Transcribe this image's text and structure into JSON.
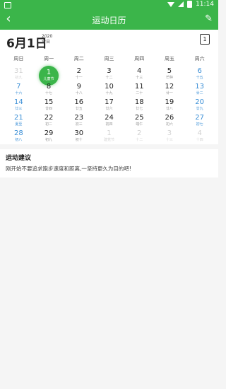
{
  "status": {
    "time": "11:14"
  },
  "appbar": {
    "title": "运动日历",
    "back": "‹",
    "share": "✎"
  },
  "header": {
    "date": "6月1日",
    "year": "2020",
    "today": "今日",
    "calendar_label": "1"
  },
  "weekdays": [
    "周日",
    "周一",
    "周二",
    "周三",
    "周四",
    "周五",
    "周六"
  ],
  "days": [
    {
      "n": "31",
      "l": "初九",
      "state": "dim"
    },
    {
      "n": "1",
      "l": "儿童节",
      "state": "today"
    },
    {
      "n": "2",
      "l": "十一",
      "state": ""
    },
    {
      "n": "3",
      "l": "十二",
      "state": ""
    },
    {
      "n": "4",
      "l": "十三",
      "state": ""
    },
    {
      "n": "5",
      "l": "芒种",
      "state": ""
    },
    {
      "n": "6",
      "l": "十五",
      "state": "wk"
    },
    {
      "n": "7",
      "l": "十六",
      "state": "wk"
    },
    {
      "n": "8",
      "l": "十七",
      "state": ""
    },
    {
      "n": "9",
      "l": "十八",
      "state": ""
    },
    {
      "n": "10",
      "l": "十九",
      "state": ""
    },
    {
      "n": "11",
      "l": "二十",
      "state": ""
    },
    {
      "n": "12",
      "l": "廿一",
      "state": ""
    },
    {
      "n": "13",
      "l": "廿二",
      "state": "wk"
    },
    {
      "n": "14",
      "l": "廿三",
      "state": "wk"
    },
    {
      "n": "15",
      "l": "廿四",
      "state": ""
    },
    {
      "n": "16",
      "l": "廿五",
      "state": ""
    },
    {
      "n": "17",
      "l": "廿六",
      "state": ""
    },
    {
      "n": "18",
      "l": "廿七",
      "state": ""
    },
    {
      "n": "19",
      "l": "廿八",
      "state": ""
    },
    {
      "n": "20",
      "l": "廿九",
      "state": "wk"
    },
    {
      "n": "21",
      "l": "夏至",
      "state": "wk"
    },
    {
      "n": "22",
      "l": "初二",
      "state": ""
    },
    {
      "n": "23",
      "l": "初三",
      "state": ""
    },
    {
      "n": "24",
      "l": "初四",
      "state": ""
    },
    {
      "n": "25",
      "l": "端午",
      "state": ""
    },
    {
      "n": "26",
      "l": "初六",
      "state": ""
    },
    {
      "n": "27",
      "l": "初七",
      "state": "wk"
    },
    {
      "n": "28",
      "l": "初八",
      "state": "wk"
    },
    {
      "n": "29",
      "l": "初九",
      "state": ""
    },
    {
      "n": "30",
      "l": "初十",
      "state": ""
    },
    {
      "n": "1",
      "l": "建党节",
      "state": "dim"
    },
    {
      "n": "2",
      "l": "十二",
      "state": "dim"
    },
    {
      "n": "3",
      "l": "十三",
      "state": "dim"
    },
    {
      "n": "4",
      "l": "十四",
      "state": "dim"
    }
  ],
  "tips": {
    "title": "运动建议",
    "text": "刚开始不要追求跑步速度和距离,一坚持更久为目的吧!"
  }
}
